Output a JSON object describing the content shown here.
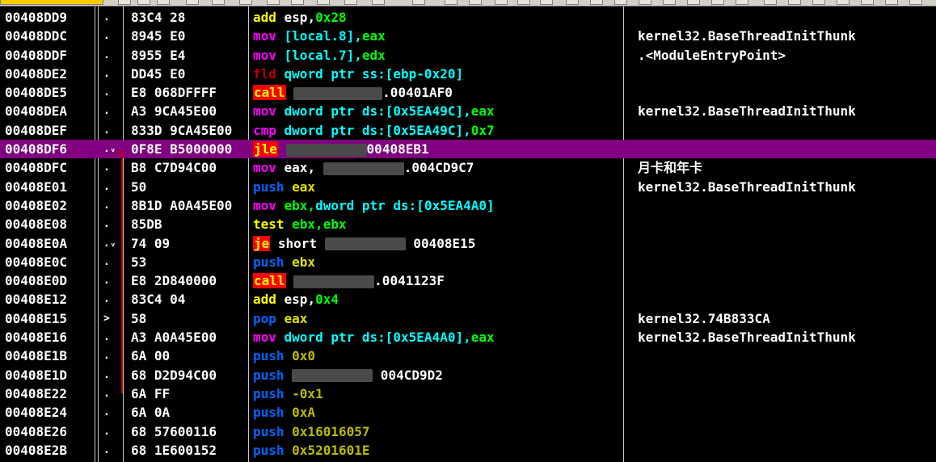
{
  "rows": [
    {
      "addr": "00408DD9",
      "mark": ".",
      "hex": "83C4 28",
      "asm": [
        {
          "t": "add",
          "c": "m-add"
        },
        {
          "t": " esp,",
          "c": "o-reg"
        },
        {
          "t": "0x28",
          "c": "o-num"
        }
      ],
      "comment": ""
    },
    {
      "addr": "00408DDC",
      "mark": ".",
      "hex": "8945 E0",
      "asm": [
        {
          "t": "mov",
          "c": "m-mov"
        },
        {
          "t": " [local.8],",
          "c": "o-mem"
        },
        {
          "t": "eax",
          "c": "o-num"
        }
      ],
      "comment": "kernel32.BaseThreadInitThunk"
    },
    {
      "addr": "00408DDF",
      "mark": ".",
      "hex": "8955 E4",
      "asm": [
        {
          "t": "mov",
          "c": "m-mov"
        },
        {
          "t": " [local.7],",
          "c": "o-mem"
        },
        {
          "t": "edx",
          "c": "o-num"
        }
      ],
      "comment": ".<ModuleEntryPoint>"
    },
    {
      "addr": "00408DE2",
      "mark": ".",
      "hex": "DD45 E0",
      "asm": [
        {
          "t": "fld",
          "c": "m-fld"
        },
        {
          "t": " qword ptr ss:[ebp-0x20]",
          "c": "o-mem"
        }
      ],
      "comment": ""
    },
    {
      "addr": "00408DE5",
      "mark": ".",
      "hex": "E8 068DFFFF",
      "asm": [
        {
          "t": "call",
          "c": "m-call"
        },
        {
          "t": " ",
          "c": "o-sym"
        },
        {
          "blur": 110
        },
        {
          "t": ".00401AF0",
          "c": "o-sym"
        }
      ],
      "comment": ""
    },
    {
      "addr": "00408DEA",
      "mark": ".",
      "hex": "A3 9CA45E00",
      "asm": [
        {
          "t": "mov",
          "c": "m-mov"
        },
        {
          "t": " dword ptr ds:[0x5EA49C],",
          "c": "o-mem"
        },
        {
          "t": "eax",
          "c": "o-num"
        }
      ],
      "comment": "kernel32.BaseThreadInitThunk"
    },
    {
      "addr": "00408DEF",
      "mark": ".",
      "hex": "833D 9CA45E00",
      "asm": [
        {
          "t": "cmp",
          "c": "m-cmp"
        },
        {
          "t": " dword ptr ds:[0x5EA49C],",
          "c": "o-mem"
        },
        {
          "t": "0x7",
          "c": "o-num"
        }
      ],
      "comment": ""
    },
    {
      "addr": "00408DF6",
      "mark": ".ᵥ",
      "hex": "0F8E B5000000",
      "asm": [
        {
          "t": "jle",
          "c": "m-jle"
        },
        {
          "t": " ",
          "c": "o-sym"
        },
        {
          "blur": 100
        },
        {
          "t": "00408EB1",
          "c": "o-sym"
        }
      ],
      "comment": "",
      "selected": true
    },
    {
      "addr": "00408DFC",
      "mark": ".",
      "hex": "B8 C7D94C00",
      "asm": [
        {
          "t": "mov",
          "c": "m-mov"
        },
        {
          "t": " eax,",
          "c": "o-reg"
        },
        {
          "t": " ",
          "c": "o-sym"
        },
        {
          "blur": 100
        },
        {
          "t": ".004CD9C7",
          "c": "o-sym"
        }
      ],
      "comment": "月卡和年卡"
    },
    {
      "addr": "00408E01",
      "mark": ".",
      "hex": "50",
      "asm": [
        {
          "t": "push",
          "c": "m-push"
        },
        {
          "t": " eax",
          "c": "o-push"
        }
      ],
      "comment": "kernel32.BaseThreadInitThunk"
    },
    {
      "addr": "00408E02",
      "mark": ".",
      "hex": "8B1D A0A45E00",
      "asm": [
        {
          "t": "mov",
          "c": "m-mov"
        },
        {
          "t": " ebx,",
          "c": "o-num"
        },
        {
          "t": "dword ptr ds:[0x5EA4A0]",
          "c": "o-mem"
        }
      ],
      "comment": ""
    },
    {
      "addr": "00408E08",
      "mark": ".",
      "hex": "85DB",
      "asm": [
        {
          "t": "test",
          "c": "m-test"
        },
        {
          "t": " ebx,ebx",
          "c": "o-num"
        }
      ],
      "comment": ""
    },
    {
      "addr": "00408E0A",
      "mark": ".ᵥ",
      "hex": "74 09",
      "asm": [
        {
          "t": "je",
          "c": "m-je"
        },
        {
          "t": " short ",
          "c": "m-short"
        },
        {
          "blur": 100
        },
        {
          "t": " 00408E15",
          "c": "o-sym"
        }
      ],
      "comment": ""
    },
    {
      "addr": "00408E0C",
      "mark": ".",
      "hex": "53",
      "asm": [
        {
          "t": "push",
          "c": "m-push"
        },
        {
          "t": " ebx",
          "c": "o-push"
        }
      ],
      "comment": ""
    },
    {
      "addr": "00408E0D",
      "mark": ".",
      "hex": "E8 2D840000",
      "asm": [
        {
          "t": "call",
          "c": "m-call"
        },
        {
          "t": " ",
          "c": "o-sym"
        },
        {
          "blur": 100
        },
        {
          "t": ".0041123F",
          "c": "o-sym"
        }
      ],
      "comment": ""
    },
    {
      "addr": "00408E12",
      "mark": ".",
      "hex": "83C4 04",
      "asm": [
        {
          "t": "add",
          "c": "m-add"
        },
        {
          "t": " esp,",
          "c": "o-reg"
        },
        {
          "t": "0x4",
          "c": "o-num"
        }
      ],
      "comment": ""
    },
    {
      "addr": "00408E15",
      "mark": ">",
      "hex": "58",
      "asm": [
        {
          "t": "pop",
          "c": "m-pop"
        },
        {
          "t": " eax",
          "c": "o-push"
        }
      ],
      "comment": "kernel32.74B833CA"
    },
    {
      "addr": "00408E16",
      "mark": ".",
      "hex": "A3 A0A45E00",
      "asm": [
        {
          "t": "mov",
          "c": "m-mov"
        },
        {
          "t": " dword ptr ds:[0x5EA4A0],",
          "c": "o-mem"
        },
        {
          "t": "eax",
          "c": "o-num"
        }
      ],
      "comment": "kernel32.BaseThreadInitThunk"
    },
    {
      "addr": "00408E1B",
      "mark": ".",
      "hex": "6A 00",
      "asm": [
        {
          "t": "push",
          "c": "m-push"
        },
        {
          "t": " 0x0",
          "c": "o-dim"
        }
      ],
      "comment": ""
    },
    {
      "addr": "00408E1D",
      "mark": ".",
      "hex": "68 D2D94C00",
      "asm": [
        {
          "t": "push",
          "c": "m-push"
        },
        {
          "t": " ",
          "c": "o-sym"
        },
        {
          "blur": 100
        },
        {
          "t": " 004CD9D2",
          "c": "o-sym"
        }
      ],
      "comment": ""
    },
    {
      "addr": "00408E22",
      "mark": ".",
      "hex": "6A FF",
      "asm": [
        {
          "t": "push",
          "c": "m-push"
        },
        {
          "t": " -0x1",
          "c": "o-dim"
        }
      ],
      "comment": ""
    },
    {
      "addr": "00408E24",
      "mark": ".",
      "hex": "6A 0A",
      "asm": [
        {
          "t": "push",
          "c": "m-push"
        },
        {
          "t": " 0xA",
          "c": "o-dim"
        }
      ],
      "comment": ""
    },
    {
      "addr": "00408E26",
      "mark": ".",
      "hex": "68 57600116",
      "asm": [
        {
          "t": "push",
          "c": "m-push"
        },
        {
          "t": " 0x16016057",
          "c": "o-dim"
        }
      ],
      "comment": ""
    },
    {
      "addr": "00408E2B",
      "mark": ".",
      "hex": "68 1E600152",
      "asm": [
        {
          "t": "push",
          "c": "m-push"
        },
        {
          "t": " 0x5201601E",
          "c": "o-dim"
        }
      ],
      "comment": ""
    }
  ]
}
